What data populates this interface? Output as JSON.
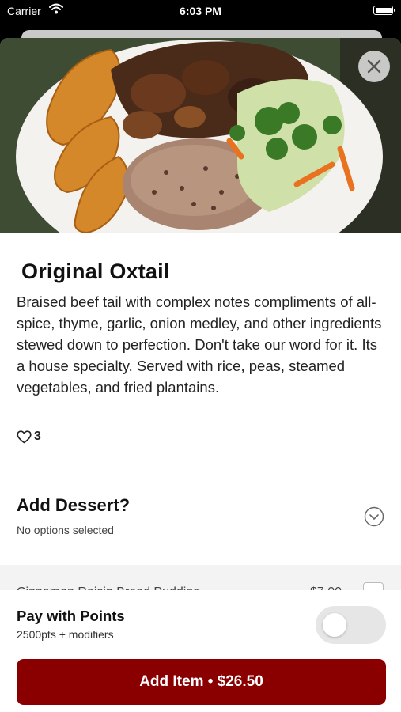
{
  "status_bar": {
    "carrier": "Carrier",
    "time": "6:03 PM"
  },
  "item": {
    "title": "Original Oxtail",
    "description": "Braised beef tail with complex notes compliments of all-spice, thyme, garlic, onion medley, and other ingredients stewed down to perfection. Don't take our word for it. Its a house specialty. Served with rice, peas, steamed vegetables, and fried plantains.",
    "likes": "3"
  },
  "dessert_section": {
    "title": "Add Dessert?",
    "subtitle": "No options selected"
  },
  "dessert_options": [
    {
      "name": "Cinnamon Raisin Bread Pudding",
      "price": "$7.00"
    }
  ],
  "footer": {
    "pay_title": "Pay with Points",
    "pay_subtitle": "2500pts + modifiers",
    "pay_with_points_enabled": false,
    "add_button_label": "Add Item • $26.50"
  },
  "colors": {
    "accent": "#8a0000",
    "toggle_off": "#e6e6e6"
  },
  "icons": {
    "close": "close-icon",
    "like": "heart-outline-icon",
    "expand": "chevron-down-circle-icon",
    "wifi": "wifi-icon",
    "battery": "battery-icon"
  }
}
